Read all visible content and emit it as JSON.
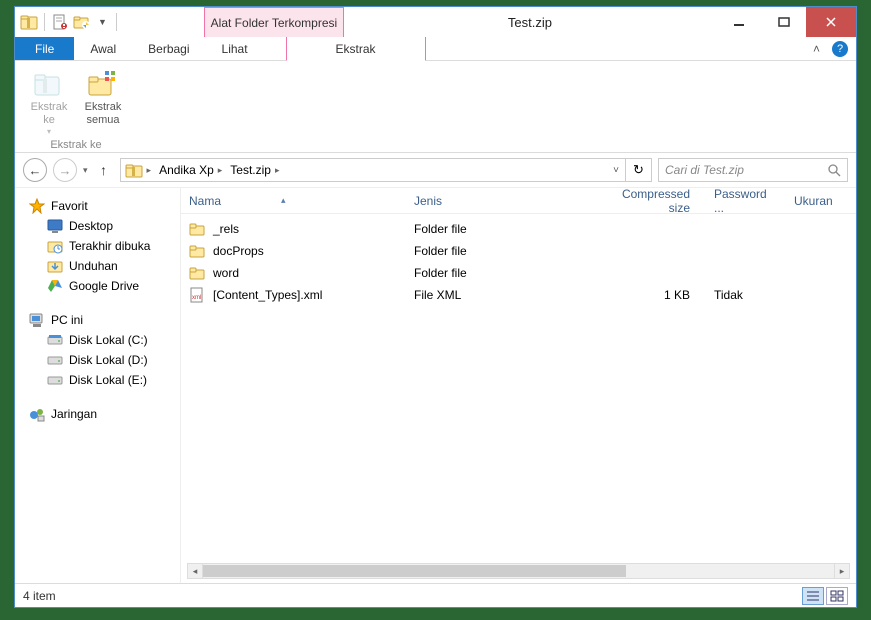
{
  "titlebar": {
    "context_tab": "Alat Folder Terkompresi",
    "window_title": "Test.zip"
  },
  "ribbon": {
    "file": "File",
    "tabs": [
      "Awal",
      "Berbagi",
      "Lihat"
    ],
    "context_tab": "Ekstrak",
    "group1_label": "Ekstrak ke",
    "btn_ekstrak_ke": "Ekstrak\nke",
    "btn_ekstrak_semua": "Ekstrak\nsemua"
  },
  "nav": {
    "address_segments": [
      "Andika Xp",
      "Test.zip"
    ],
    "search_placeholder": "Cari di Test.zip"
  },
  "tree": {
    "favorites_label": "Favorit",
    "favorites": [
      "Desktop",
      "Terakhir dibuka",
      "Unduhan",
      "Google Drive"
    ],
    "pc_label": "PC ini",
    "drives": [
      "Disk Lokal (C:)",
      "Disk Lokal (D:)",
      "Disk Lokal (E:)"
    ],
    "network_label": "Jaringan"
  },
  "columns": {
    "name": "Nama",
    "type": "Jenis",
    "size": "Compressed size",
    "pwd": "Password ...",
    "uk": "Ukuran"
  },
  "rows": [
    {
      "name": "_rels",
      "type": "Folder file",
      "size": "",
      "pwd": "",
      "icon": "folder"
    },
    {
      "name": "docProps",
      "type": "Folder file",
      "size": "",
      "pwd": "",
      "icon": "folder"
    },
    {
      "name": "word",
      "type": "Folder file",
      "size": "",
      "pwd": "",
      "icon": "folder"
    },
    {
      "name": "[Content_Types].xml",
      "type": "File XML",
      "size": "1 KB",
      "pwd": "Tidak",
      "icon": "xml"
    }
  ],
  "status": {
    "item_count": "4 item"
  }
}
